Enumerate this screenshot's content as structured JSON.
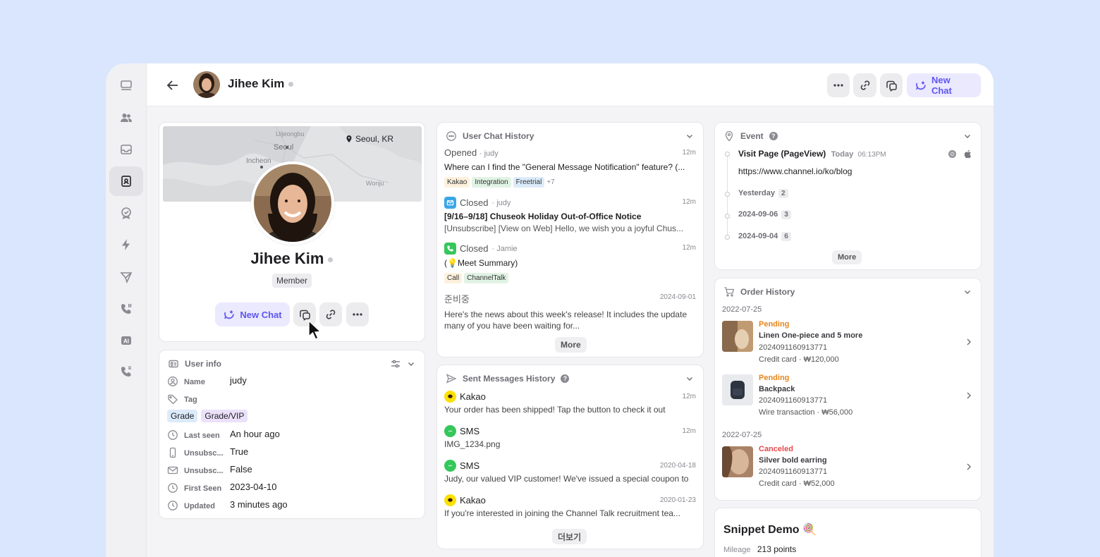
{
  "header": {
    "name": "Jihee Kim",
    "new_chat_label": "New Chat"
  },
  "rail": {
    "icons": [
      "desk-icon",
      "users-icon",
      "inbox-icon",
      "contact-icon",
      "badge-check-icon",
      "bolt-icon",
      "send-icon",
      "phone-icon",
      "ai-icon",
      "phone-alt-icon"
    ]
  },
  "profile": {
    "location": "Seoul, KR",
    "map_labels": [
      "Uijeongbu",
      "Seoul",
      "Incheon",
      "Wonju"
    ],
    "name": "Jihee Kim",
    "badge": "Member",
    "new_chat_label": "New Chat"
  },
  "user_info": {
    "title": "User info",
    "fields": [
      {
        "label": "Name",
        "value": "judy"
      },
      {
        "label": "Tag",
        "value": ""
      },
      {
        "label": "Last seen",
        "value": "An hour ago"
      },
      {
        "label": "Unsubsc...",
        "value": "True"
      },
      {
        "label": "Unsubsc...",
        "value": "False"
      },
      {
        "label": "First Seen",
        "value": "2023-04-10"
      },
      {
        "label": "Updated",
        "value": "3 minutes ago"
      }
    ],
    "tags": [
      "Grade",
      "Grade/VIP"
    ]
  },
  "chat_history": {
    "title": "User Chat History",
    "items": [
      {
        "status": "Opened",
        "agent": "· judy",
        "time": "12m",
        "text": "Where can I find the \"General Message Notification\" feature? (...",
        "tags": [
          "Kakao",
          "Integration",
          "Freetrial"
        ],
        "extra": "+7"
      },
      {
        "status": "Closed",
        "agent": "· judy",
        "time": "12m",
        "title": "[9/16–9/18] Chuseok Holiday Out-of-Office Notice",
        "text": "[Unsubscribe] [View on Web] Hello, we wish you a joyful Chus..."
      },
      {
        "status": "Closed",
        "agent": "· Jamie",
        "time": "12m",
        "text": "(💡Meet Summary)",
        "tags": [
          "Call",
          "ChannelTalk"
        ]
      },
      {
        "status": "준비중",
        "time": "2024-09-01",
        "text": "Here's the news about this week's release! It includes the update many of you have been waiting for..."
      }
    ],
    "more_label": "More"
  },
  "sent_history": {
    "title": "Sent Messages History",
    "items": [
      {
        "channel": "Kakao",
        "time": "12m",
        "text": "Your order has been shipped! Tap the button to check it out"
      },
      {
        "channel": "SMS",
        "time": "12m",
        "text": "IMG_1234.png"
      },
      {
        "channel": "SMS",
        "time": "2020-04-18",
        "text": "Judy, our valued VIP customer! We've issued a special coupon to"
      },
      {
        "channel": "Kakao",
        "time": "2020-01-23",
        "text": "If you're interested in joining the Channel Talk recruitment tea..."
      }
    ],
    "more_label": "더보기"
  },
  "event": {
    "title": "Event",
    "first": {
      "name": "Visit Page (PageView)",
      "day": "Today",
      "time": "06:13PM",
      "url": "https://www.channel.io/ko/blog"
    },
    "groups": [
      {
        "label": "Yesterday",
        "count": "2"
      },
      {
        "label": "2024-09-06",
        "count": "3"
      },
      {
        "label": "2024-09-04",
        "count": "6"
      }
    ],
    "more_label": "More"
  },
  "orders": {
    "title": "Order History",
    "date1": "2022-07-25",
    "date2": "2022-07-25",
    "items": [
      {
        "status": "Pending",
        "name": "Linen One-piece  and 5 more",
        "id": "2024091160913771",
        "pay": "Credit card · ₩120,000",
        "status_color": "#e8851d"
      },
      {
        "status": "Pending",
        "name": "Backpack",
        "id": "2024091160913771",
        "pay": "Wire transaction · ₩56,000",
        "status_color": "#e8851d"
      },
      {
        "status": "Canceled",
        "name": "Silver bold earring",
        "id": "2024091160913771",
        "pay": "Credit card · ₩52,000",
        "status_color": "#e5484d"
      }
    ]
  },
  "snippet": {
    "title": "Snippet Demo 🍭",
    "mileage_label": "Mileage",
    "mileage_value": "213 points"
  }
}
